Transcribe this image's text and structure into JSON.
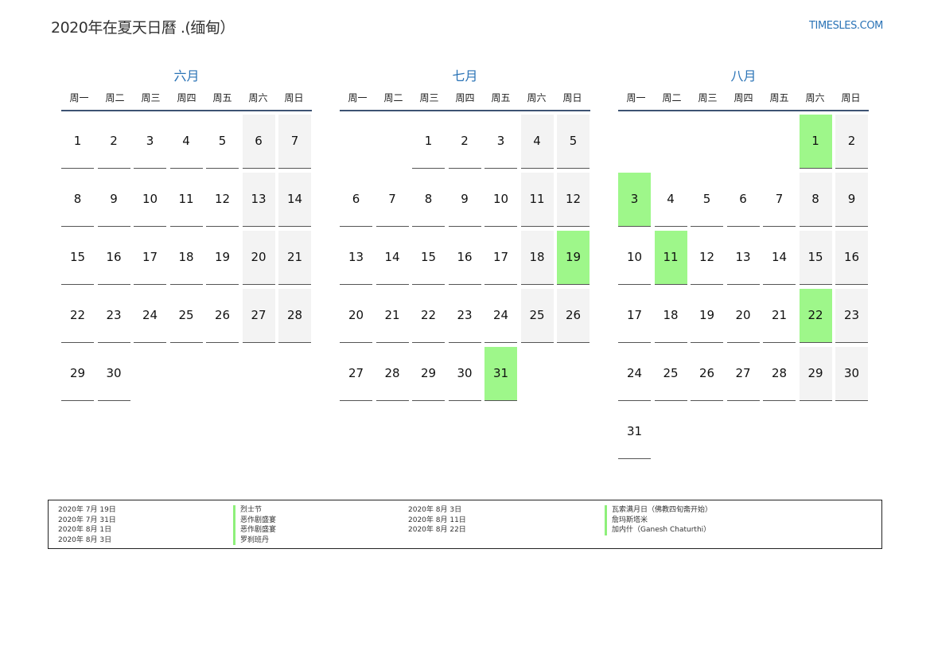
{
  "header": {
    "title": "2020年在夏天日曆 .(缅甸）",
    "brand": "TIMESLES.COM"
  },
  "weekdays": [
    "周一",
    "周二",
    "周三",
    "周四",
    "周五",
    "周六",
    "周日"
  ],
  "months": [
    {
      "name": "六月",
      "offset": 0,
      "days": 30,
      "holidays": []
    },
    {
      "name": "七月",
      "offset": 2,
      "days": 31,
      "holidays": [
        19,
        31
      ]
    },
    {
      "name": "八月",
      "offset": 5,
      "days": 31,
      "holidays": [
        1,
        3,
        11,
        22
      ]
    }
  ],
  "legend": {
    "col1_dates": [
      "2020年 7月 19日",
      "2020年 7月 31日",
      "2020年 8月 1日",
      "2020年 8月 3日"
    ],
    "col1_names": [
      "烈士节",
      "恶作剧盛宴",
      "恶作剧盛宴",
      "罗刹班丹"
    ],
    "col2_dates": [
      "2020年 8月 3日",
      "2020年 8月 11日",
      "2020年 8月 22日"
    ],
    "col2_names": [
      "瓦索满月日（佛教四旬斋开始）",
      "詹玛斯塔米",
      "加内什（Ganesh Chaturthi）"
    ]
  },
  "colors": {
    "accent": "#2a73b6",
    "holiday": "#9ef78a",
    "weekend": "#f3f3f3",
    "header_rule": "#3d5373"
  }
}
